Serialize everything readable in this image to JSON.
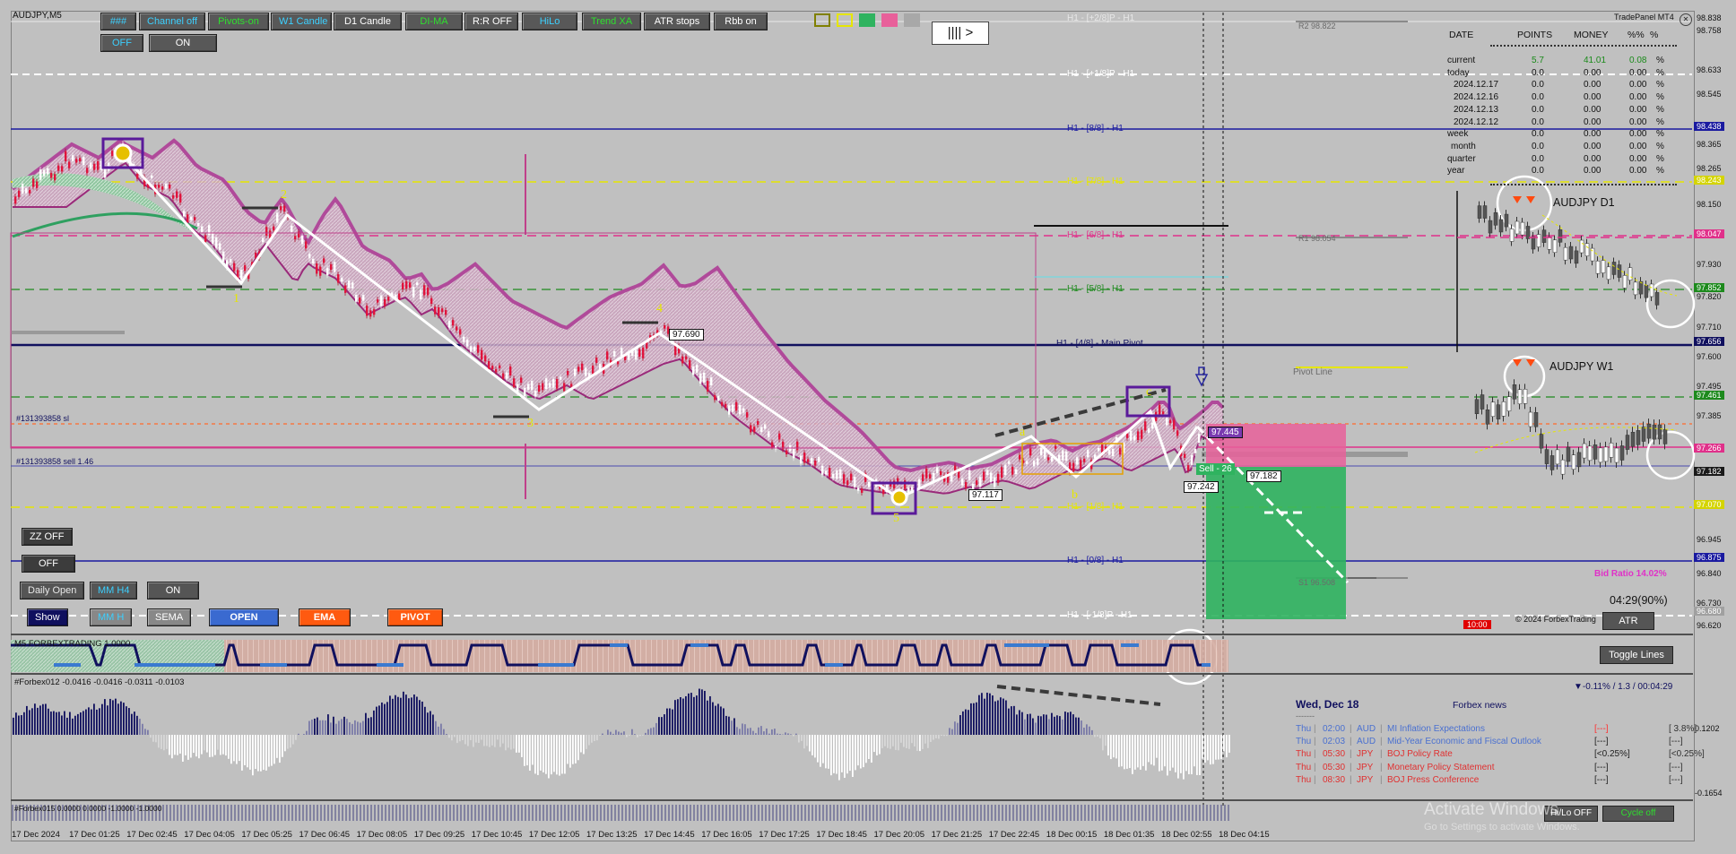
{
  "symbol_title": "AUDJPY,M5",
  "panel_title": "TradePanel MT4",
  "toolbar": {
    "row1": [
      {
        "label": "###",
        "color": "#3cd0ff"
      },
      {
        "label": "Channel off",
        "color": "#3cd0ff"
      },
      {
        "label": "Pivots-on",
        "color": "#2ee02e"
      },
      {
        "label": "W1 Candle",
        "color": "#3cd0ff"
      },
      {
        "label": "D1 Candle",
        "color": "#ffffff"
      },
      {
        "label": "DI-MA",
        "color": "#2ee02e"
      },
      {
        "label": "R:R OFF",
        "color": "#ffffff"
      },
      {
        "label": "HiLo",
        "color": "#3cd0ff"
      },
      {
        "label": "Trend XA",
        "color": "#2ee02e"
      },
      {
        "label": "ATR stops",
        "color": "#ffffff"
      },
      {
        "label": "Rbb on",
        "color": "#ffffff"
      }
    ],
    "row2": [
      {
        "label": "OFF",
        "color": "#3cd0ff"
      },
      {
        "label": "ON",
        "color": "#ffffff"
      }
    ],
    "nav_glyph": "||||   >"
  },
  "left_controls": {
    "zz": "ZZ OFF",
    "off": "OFF",
    "daily_open": "Daily Open",
    "mm_h4": "MM H4",
    "on": "ON",
    "show": "Show",
    "mm_h": "MM H",
    "sema": "SEMA",
    "open": "OPEN",
    "ema": "EMA",
    "pivot": "PIVOT"
  },
  "murrey_labels": [
    {
      "text": "H1 - [+2/8]P - H1",
      "color": "#e8e8e8"
    },
    {
      "text": "H1 - [+1/8]P - H1",
      "color": "#ffffff"
    },
    {
      "text": "H1 - [8/8] - H1",
      "color": "#1a1aa0"
    },
    {
      "text": "H1 - [7/8] - H1",
      "color": "#e8e800"
    },
    {
      "text": "H1 - [6/8] - H1",
      "color": "#e0308a"
    },
    {
      "text": "H1 - [5/8] - H1",
      "color": "#1d8a1d"
    },
    {
      "text": "H1 - [4/8] - Main Pivot",
      "color": "#10105e"
    },
    {
      "text": "H1 - [1/8] - H1",
      "color": "#e8e800"
    },
    {
      "text": "H1 - [0/8] - H1",
      "color": "#1a1aa0"
    },
    {
      "text": "H1 - [-1/8]P - H1",
      "color": "#ffffff"
    }
  ],
  "pivot_labels": {
    "r2": "R2 98.822",
    "r1": "R1 98.054",
    "pivot_line": "Pivot Line",
    "s1": "S1 96.508"
  },
  "order_labels": {
    "sl": "#131393858 sl",
    "sell": "#131393858 sell 1.46",
    "sell_tag": "Sell - 26",
    "price_tag": "97.182"
  },
  "wave_labels": [
    "1",
    "2",
    "3",
    "4",
    "5",
    "a",
    "b",
    "c"
  ],
  "price_tags": {
    "p4": "97.690",
    "p5": "97.117",
    "pb": "97.242",
    "pc": "97.445"
  },
  "price_axis": [
    {
      "text": "98.838",
      "highlight": false
    },
    {
      "text": "98.758",
      "highlight": false
    },
    {
      "text": "98.633",
      "highlight": false
    },
    {
      "text": "98.545",
      "highlight": false
    },
    {
      "text": "98.438",
      "highlight": true,
      "bg": "#1a1aa0"
    },
    {
      "text": "98.365",
      "highlight": false
    },
    {
      "text": "98.265",
      "highlight": false
    },
    {
      "text": "98.243",
      "highlight": true,
      "bg": "#d4d400"
    },
    {
      "text": "98.150",
      "highlight": false
    },
    {
      "text": "98.047",
      "highlight": true,
      "bg": "#e0308a"
    },
    {
      "text": "97.930",
      "highlight": false
    },
    {
      "text": "97.852",
      "highlight": true,
      "bg": "#1d8a1d"
    },
    {
      "text": "97.820",
      "highlight": false
    },
    {
      "text": "97.710",
      "highlight": false
    },
    {
      "text": "97.656",
      "highlight": true,
      "bg": "#10105e"
    },
    {
      "text": "97.600",
      "highlight": false
    },
    {
      "text": "97.495",
      "highlight": false
    },
    {
      "text": "97.461",
      "highlight": true,
      "bg": "#1d8a1d"
    },
    {
      "text": "97.385",
      "highlight": false
    },
    {
      "text": "97.266",
      "highlight": true,
      "bg": "#e0308a"
    },
    {
      "text": "97.182",
      "highlight": true,
      "bg": "#1a1a1a"
    },
    {
      "text": "97.070",
      "highlight": true,
      "bg": "#d4d400"
    },
    {
      "text": "96.945",
      "highlight": false
    },
    {
      "text": "96.875",
      "highlight": true,
      "bg": "#1a1aa0"
    },
    {
      "text": "96.840",
      "highlight": false
    },
    {
      "text": "96.730",
      "highlight": false
    },
    {
      "text": "96.680",
      "highlight": true,
      "bg": "#a0a0a0"
    },
    {
      "text": "96.620",
      "highlight": false
    }
  ],
  "stats_table": {
    "headers": [
      "DATE",
      "POINTS",
      "MONEY",
      "%%",
      "%"
    ],
    "rows": [
      {
        "date": "current",
        "points": "5.7",
        "money": "41.01",
        "pct": "0.08",
        "unit": "%",
        "highlight": true
      },
      {
        "date": "today",
        "points": "0.0",
        "money": "0.00",
        "pct": "0.00",
        "unit": "%"
      },
      {
        "date": "2024.12.17",
        "points": "0.0",
        "money": "0.00",
        "pct": "0.00",
        "unit": "%"
      },
      {
        "date": "2024.12.16",
        "points": "0.0",
        "money": "0.00",
        "pct": "0.00",
        "unit": "%"
      },
      {
        "date": "2024.12.13",
        "points": "0.0",
        "money": "0.00",
        "pct": "0.00",
        "unit": "%"
      },
      {
        "date": "2024.12.12",
        "points": "0.0",
        "money": "0.00",
        "pct": "0.00",
        "unit": "%"
      },
      {
        "date": "week",
        "points": "0.0",
        "money": "0.00",
        "pct": "0.00",
        "unit": "%"
      },
      {
        "date": "month",
        "points": "0.0",
        "money": "0.00",
        "pct": "0.00",
        "unit": "%"
      },
      {
        "date": "quarter",
        "points": "0.0",
        "money": "0.00",
        "pct": "0.00",
        "unit": "%"
      },
      {
        "date": "year",
        "points": "0.0",
        "money": "0.00",
        "pct": "0.00",
        "unit": "%"
      }
    ]
  },
  "mini_charts": {
    "d1": "AUDJPY D1",
    "w1": "AUDJPY W1"
  },
  "bid_ratio": "Bid Ratio 14.02%",
  "copyright": "© 2024 ForbexTrading",
  "timer": "04:29(90%)",
  "atr_button": "ATR",
  "time_badge": "10:00",
  "sub_indicator": "M5 FORBEXTRADING 1.0000",
  "toggle_lines": "Toggle Lines",
  "osc_title": "#Forbex012 -0.0416 -0.0416 -0.0311 -0.0103",
  "osc_axis": [
    "0.1202",
    "-0.1654"
  ],
  "osc_status": "▼-0.11% / 1.3 / 00:04:29",
  "mini_indicator": "#Forbex015 0.0000 0.0000 -1.0000 -1.0000",
  "news": {
    "date": "Wed, Dec 18",
    "title": "Forbex news",
    "items": [
      {
        "day": "Thu",
        "time": "02:00",
        "cur": "AUD",
        "event": "MI Inflation Expectations",
        "fc": "[---]",
        "prev": "[ 3.8%]",
        "color": "#4a70d0",
        "fc_color": "#ff3030"
      },
      {
        "day": "Thu",
        "time": "02:03",
        "cur": "AUD",
        "event": "Mid-Year Economic and Fiscal Outlook",
        "fc": "[---]",
        "prev": "[---]",
        "color": "#4a70d0",
        "fc_color": "#202020"
      },
      {
        "day": "Thu",
        "time": "05:30",
        "cur": "JPY",
        "event": "BOJ Policy Rate",
        "fc": "[<0.25%]",
        "prev": "[<0.25%]",
        "color": "#e03030",
        "fc_color": "#202020"
      },
      {
        "day": "Thu",
        "time": "05:30",
        "cur": "JPY",
        "event": "Monetary Policy Statement",
        "fc": "[---]",
        "prev": "[---]",
        "color": "#e03030",
        "fc_color": "#202020"
      },
      {
        "day": "Thu",
        "time": "08:30",
        "cur": "JPY",
        "event": "BOJ Press Conference",
        "fc": "[---]",
        "prev": "[---]",
        "color": "#e03030",
        "fc_color": "#202020"
      }
    ]
  },
  "bottom_buttons": {
    "hilo": "Hi/Lo OFF",
    "cycle": "Cycle off"
  },
  "watermark": {
    "line1": "Activate Windows",
    "line2": "Go to Settings to activate Windows."
  },
  "time_axis": [
    "17 Dec 2024",
    "17 Dec 01:25",
    "17 Dec 02:45",
    "17 Dec 04:05",
    "17 Dec 05:25",
    "17 Dec 06:45",
    "17 Dec 08:05",
    "17 Dec 09:25",
    "17 Dec 10:45",
    "17 Dec 12:05",
    "17 Dec 13:25",
    "17 Dec 14:45",
    "17 Dec 16:05",
    "17 Dec 17:25",
    "17 Dec 18:45",
    "17 Dec 20:05",
    "17 Dec 21:25",
    "17 Dec 22:45",
    "18 Dec 00:15",
    "18 Dec 01:35",
    "18 Dec 02:55",
    "18 Dec 04:15"
  ],
  "colors": {
    "background": "#c0c0c0",
    "bull_candle": "#ffffff",
    "bear_candle": "#e0143c",
    "ma_band": "#b04a9a",
    "zigzag": "#ffffff",
    "tp_zone": "#2fb35f",
    "sl_zone": "#e8609a"
  }
}
